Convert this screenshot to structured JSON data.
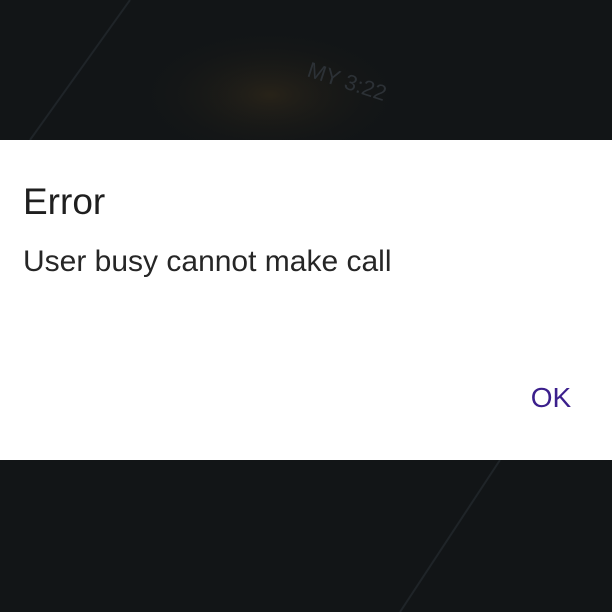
{
  "background": {
    "overlay_text": "MY 3:22"
  },
  "dialog": {
    "title": "Error",
    "message": "User busy cannot make call",
    "ok_label": "OK"
  },
  "colors": {
    "scrim": "#121517",
    "dialog_bg": "#ffffff",
    "accent": "#3b1f8c"
  }
}
